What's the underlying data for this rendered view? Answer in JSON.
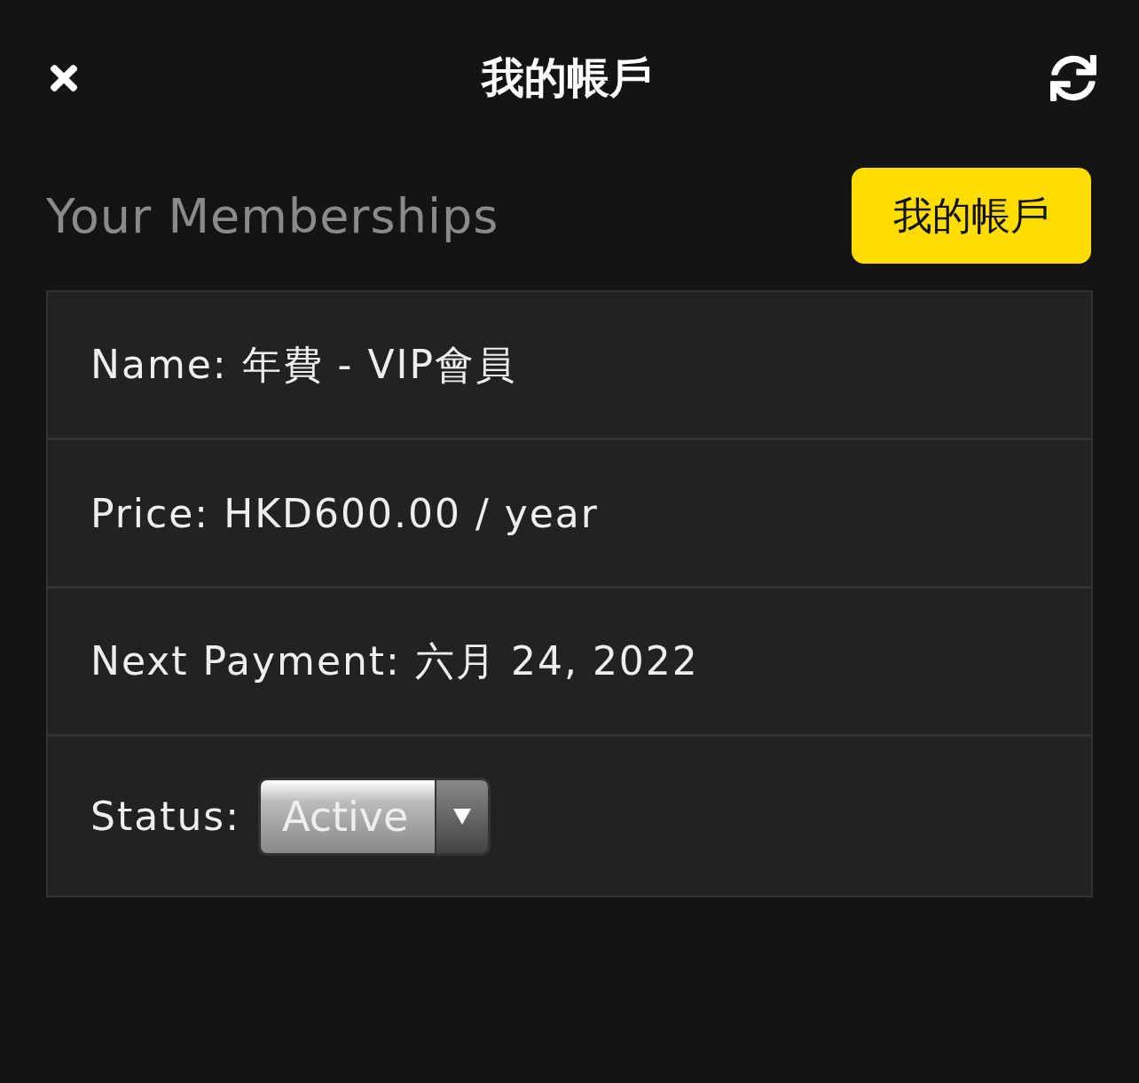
{
  "header": {
    "title": "我的帳戶"
  },
  "section": {
    "heading": "Your Memberships",
    "button": "我的帳戶"
  },
  "rows": [
    {
      "kind": "text",
      "text": "Name: 年費 - VIP會員"
    },
    {
      "kind": "text",
      "text": "Price: HKD600.00 / year"
    },
    {
      "kind": "text",
      "text": "Next Payment: 六月 24, 2022"
    },
    {
      "kind": "select",
      "label": "Status:",
      "value": "Active"
    }
  ]
}
